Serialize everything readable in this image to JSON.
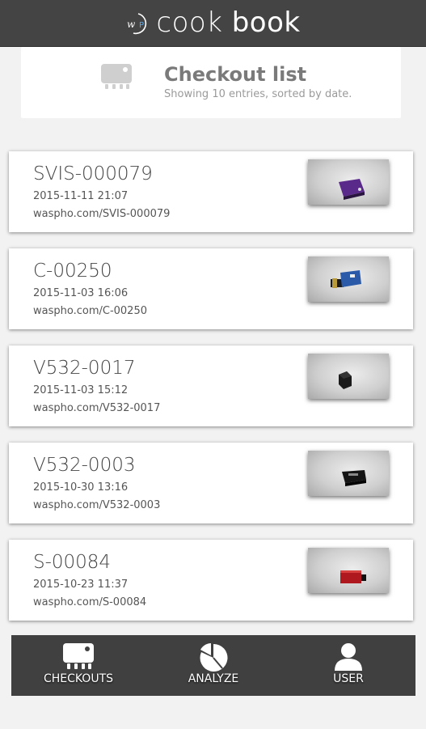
{
  "app": {
    "brand_mark": "WP",
    "title_part1": "cook",
    "title_part2": "book"
  },
  "header": {
    "icon": "device-icon",
    "title": "Checkout list",
    "subtitle": "Showing 10 entries, sorted by date."
  },
  "entries": [
    {
      "code": "SVIS-000079",
      "datetime": "2015-11-11 21:07",
      "url": "waspho.com/SVIS-000079",
      "device_color": "#5a2a8a"
    },
    {
      "code": "C-00250",
      "datetime": "2015-11-03 16:06",
      "url": "waspho.com/C-00250",
      "device_color": "#2a5aa8"
    },
    {
      "code": "V532-0017",
      "datetime": "2015-11-03 15:12",
      "url": "waspho.com/V532-0017",
      "device_color": "#1a1a1a"
    },
    {
      "code": "V532-0003",
      "datetime": "2015-10-30 13:16",
      "url": "waspho.com/V532-0003",
      "device_color": "#151515"
    },
    {
      "code": "S-00084",
      "datetime": "2015-10-23 11:37",
      "url": "waspho.com/S-00084",
      "device_color": "#b01820"
    }
  ],
  "nav": {
    "checkouts": {
      "label": "CHECKOUTS",
      "icon": "device-icon"
    },
    "analyze": {
      "label": "ANALYZE",
      "icon": "pie-chart-icon"
    },
    "user": {
      "label": "USER",
      "icon": "user-icon"
    }
  },
  "colors": {
    "topbar": "#444444",
    "bottombar": "#404040",
    "background": "#f2f2f2"
  }
}
